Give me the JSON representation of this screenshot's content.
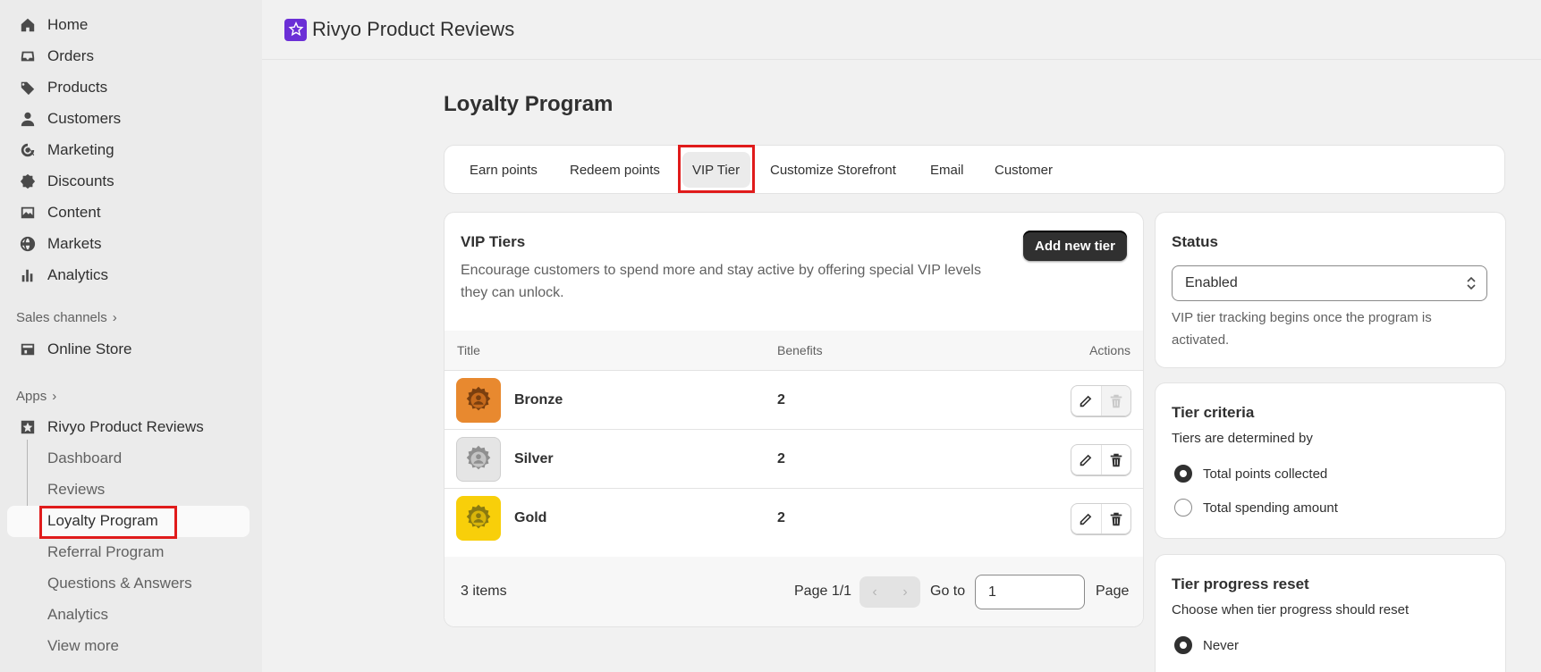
{
  "sidebar": {
    "nav": [
      {
        "label": "Home",
        "icon": "home-icon"
      },
      {
        "label": "Orders",
        "icon": "inbox-icon"
      },
      {
        "label": "Products",
        "icon": "tag-icon"
      },
      {
        "label": "Customers",
        "icon": "person-icon"
      },
      {
        "label": "Marketing",
        "icon": "target-icon"
      },
      {
        "label": "Discounts",
        "icon": "discount-icon"
      },
      {
        "label": "Content",
        "icon": "image-icon"
      },
      {
        "label": "Markets",
        "icon": "globe-icon"
      },
      {
        "label": "Analytics",
        "icon": "bar-chart-icon"
      }
    ],
    "sales_channels_label": "Sales channels",
    "online_store": "Online Store",
    "apps_label": "Apps",
    "app_name": "Rivyo Product Reviews",
    "sub_items": [
      "Dashboard",
      "Reviews",
      "Loyalty Program",
      "Referral Program",
      "Questions & Answers",
      "Analytics",
      "View more"
    ]
  },
  "header": {
    "app_title": "Rivyo Product Reviews"
  },
  "page": {
    "title": "Loyalty Program"
  },
  "tabs": [
    "Earn points",
    "Redeem points",
    "VIP Tier",
    "Customize Storefront",
    "Email",
    "Customer"
  ],
  "vip": {
    "title": "VIP Tiers",
    "description_line1": "Encourage customers to spend more and stay active by offering special VIP levels",
    "description_line2": "they can unlock.",
    "add_button": "Add new tier",
    "columns": {
      "title": "Title",
      "benefits": "Benefits",
      "actions": "Actions"
    },
    "rows": [
      {
        "name": "Bronze",
        "benefits": "2",
        "color": "#e8892f"
      },
      {
        "name": "Silver",
        "benefits": "2",
        "color": "#e5e5e5"
      },
      {
        "name": "Gold",
        "benefits": "2",
        "color": "#f8cf0a"
      }
    ],
    "items_count": "3 items",
    "page_label": "Page 1/1",
    "goto_label": "Go to",
    "goto_value": "1",
    "page_suffix": "Page"
  },
  "status": {
    "title": "Status",
    "value": "Enabled",
    "help_line1": "VIP tier tracking begins once the program is",
    "help_line2": "activated."
  },
  "criteria": {
    "title": "Tier criteria",
    "subtitle": "Tiers are determined by",
    "options": [
      "Total points collected",
      "Total spending amount"
    ]
  },
  "reset": {
    "title": "Tier progress reset",
    "subtitle": "Choose when tier progress should reset",
    "options": [
      "Never"
    ]
  },
  "colors": {
    "accent_red": "#e01b1b",
    "app_logo": "#6b2fd6"
  }
}
